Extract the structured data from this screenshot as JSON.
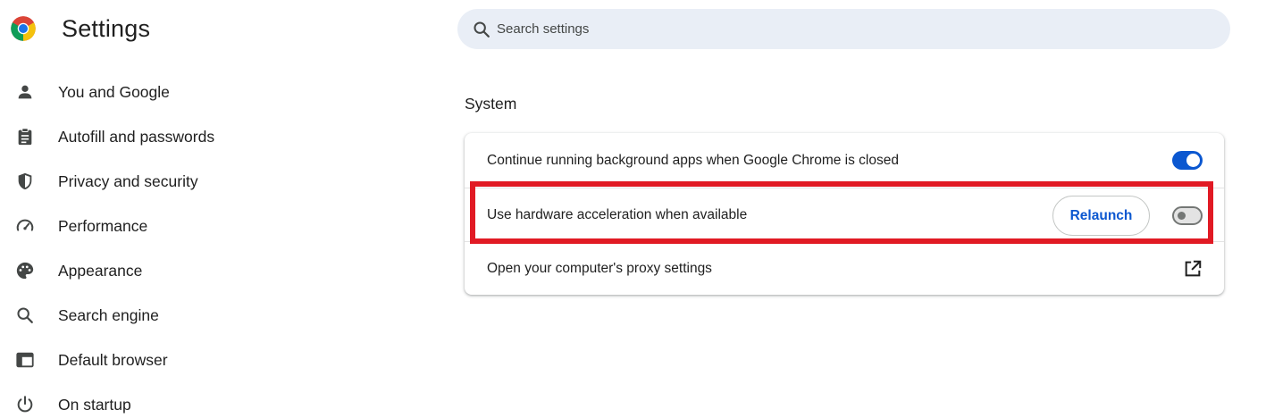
{
  "app": {
    "title": "Settings"
  },
  "search": {
    "placeholder": "Search settings"
  },
  "sidebar": {
    "items": [
      {
        "label": "You and Google",
        "icon": "person-icon"
      },
      {
        "label": "Autofill and passwords",
        "icon": "clipboard-icon"
      },
      {
        "label": "Privacy and security",
        "icon": "shield-icon"
      },
      {
        "label": "Performance",
        "icon": "speedometer-icon"
      },
      {
        "label": "Appearance",
        "icon": "palette-icon"
      },
      {
        "label": "Search engine",
        "icon": "search-icon"
      },
      {
        "label": "Default browser",
        "icon": "browser-window-icon"
      },
      {
        "label": "On startup",
        "icon": "power-icon"
      }
    ]
  },
  "system": {
    "title": "System",
    "rows": [
      {
        "label": "Continue running background apps when Google Chrome is closed",
        "toggle": "on"
      },
      {
        "label": "Use hardware acceleration when available",
        "toggle": "off",
        "button": "Relaunch"
      },
      {
        "label": "Open your computer's proxy settings",
        "icon": "open-external-icon"
      }
    ]
  },
  "colors": {
    "accent": "#0b57d0",
    "highlight": "#e11a24",
    "search_bg": "#e9eef6"
  }
}
